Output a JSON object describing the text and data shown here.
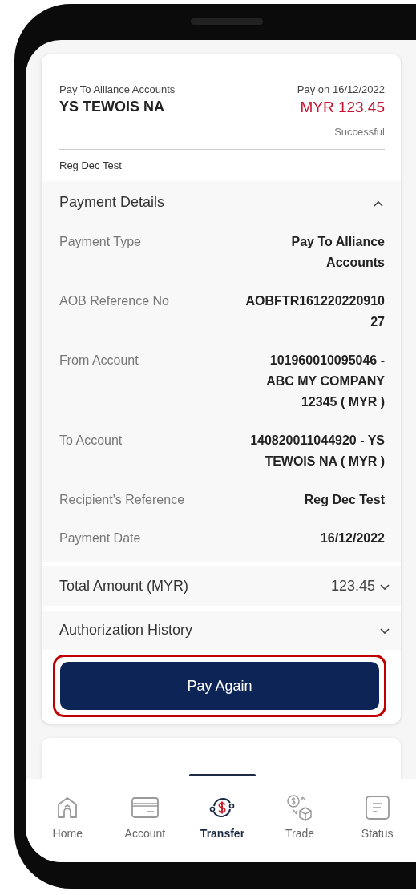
{
  "summary": {
    "subtitle": "Pay To Alliance Accounts",
    "payee": "YS TEWOIS NA",
    "date": "Pay on 16/12/2022",
    "amount": "MYR 123.45",
    "status": "Successful"
  },
  "note": "Reg Dec Test",
  "payment_details": {
    "title": "Payment Details",
    "expanded": true,
    "rows": [
      {
        "label": "Payment Type",
        "value": "Pay To Alliance Accounts"
      },
      {
        "label": "AOB Reference No",
        "value": "AOBFTR16122022091027"
      },
      {
        "label": "From Account",
        "value": "101960010095046 - ABC MY COMPANY 12345 ( MYR )"
      },
      {
        "label": "To Account",
        "value": "140820011044920 - YS TEWOIS NA ( MYR )"
      },
      {
        "label": "Recipient's Reference",
        "value": "Reg Dec Test"
      },
      {
        "label": "Payment Date",
        "value": "16/12/2022"
      }
    ]
  },
  "total": {
    "label": "Total Amount (MYR)",
    "value": "123.45",
    "expanded": false
  },
  "authorization": {
    "label": "Authorization History",
    "expanded": false
  },
  "button": {
    "label": "Pay Again",
    "highlighted": true
  },
  "nav": [
    {
      "kind": "home",
      "label": "Home",
      "selected": false
    },
    {
      "kind": "account",
      "label": "Account",
      "selected": false
    },
    {
      "kind": "transfer",
      "label": "Transfer",
      "selected": true
    },
    {
      "kind": "trade",
      "label": "Trade",
      "selected": false
    },
    {
      "kind": "status",
      "label": "Status",
      "selected": false
    }
  ]
}
